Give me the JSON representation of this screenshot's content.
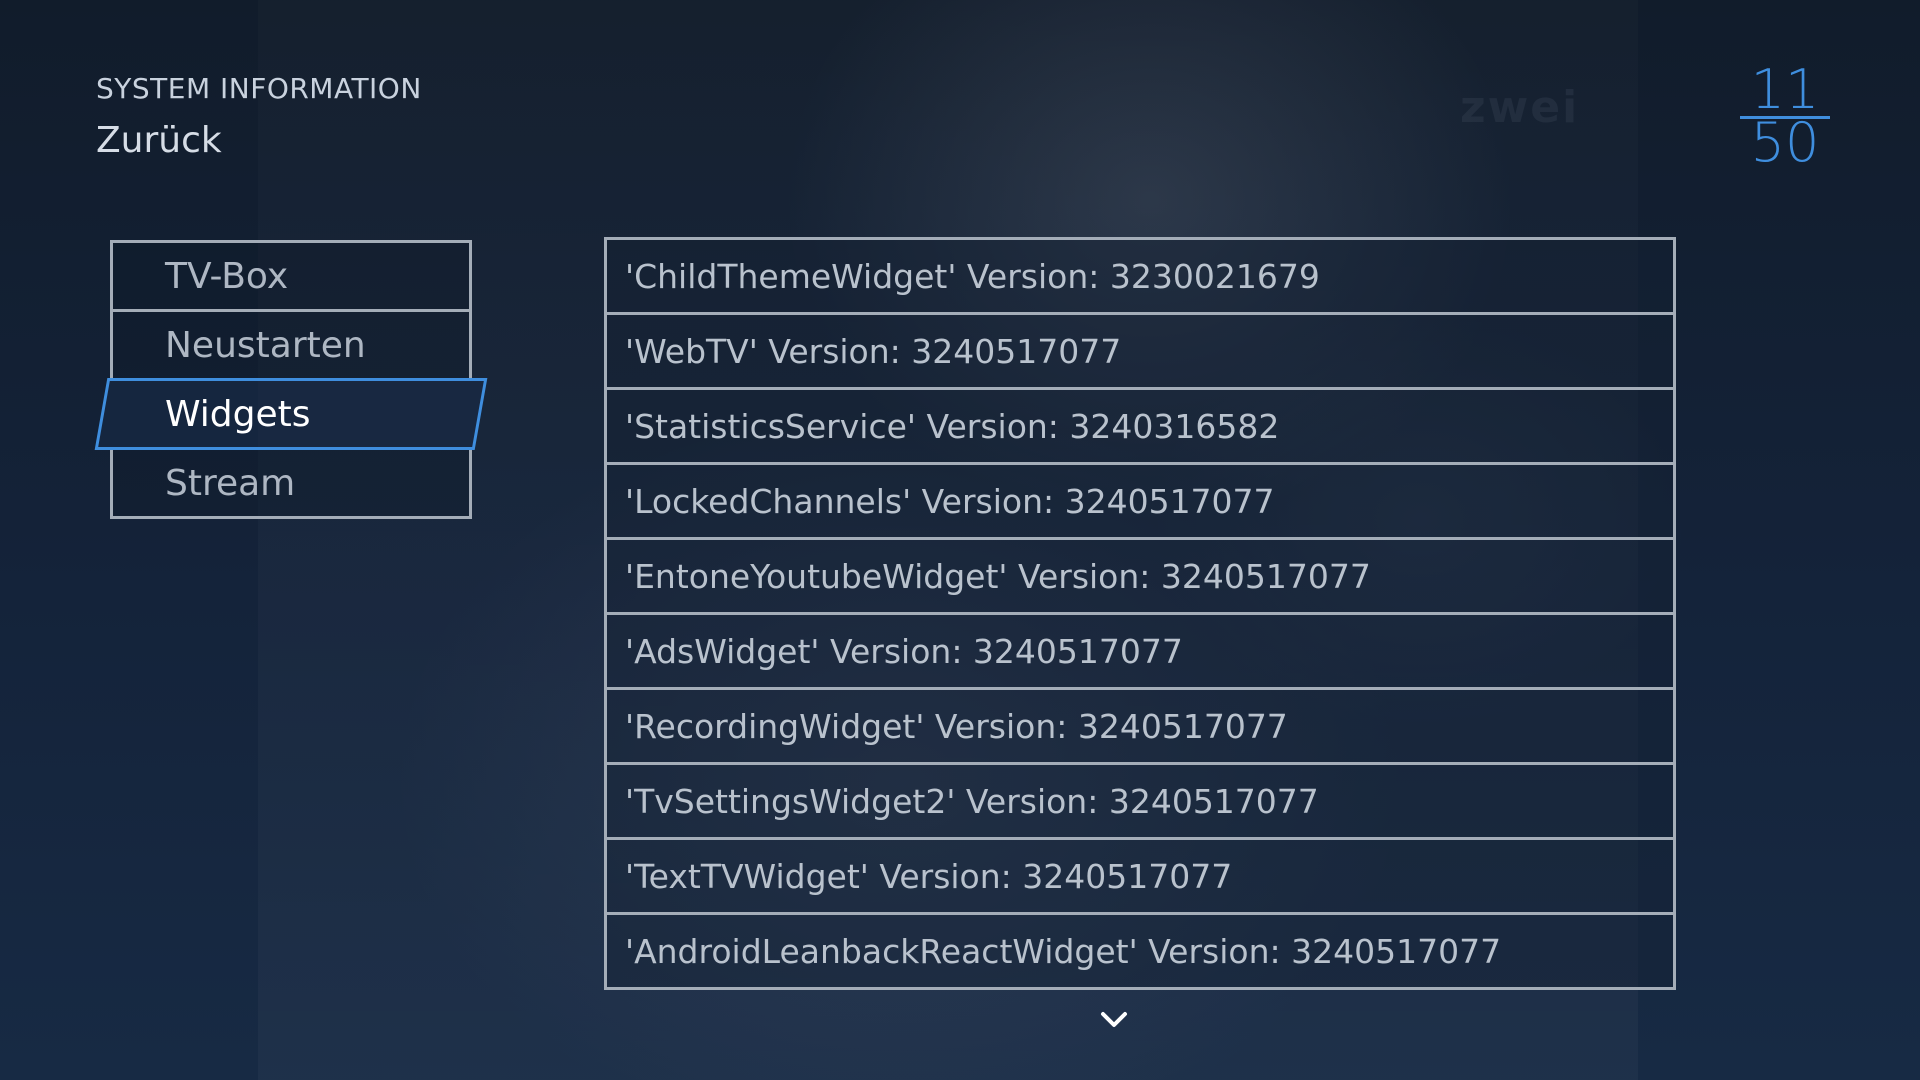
{
  "header": {
    "subtitle": "SYSTEM INFORMATION",
    "back_label": "Zurück"
  },
  "clock": {
    "hours": "11",
    "minutes": "50"
  },
  "background": {
    "watermark": "zwei"
  },
  "menu": {
    "items": [
      {
        "label": "TV-Box"
      },
      {
        "label": "Neustarten"
      },
      {
        "label": "Widgets"
      },
      {
        "label": "Stream"
      }
    ],
    "selected": "Widgets"
  },
  "widgets": {
    "rows": [
      {
        "text": "'ChildThemeWidget' Version: 3230021679"
      },
      {
        "text": "'WebTV' Version: 3240517077"
      },
      {
        "text": "'StatisticsService' Version: 3240316582"
      },
      {
        "text": "'LockedChannels' Version: 3240517077"
      },
      {
        "text": "'EntoneYoutubeWidget' Version: 3240517077"
      },
      {
        "text": "'AdsWidget' Version: 3240517077"
      },
      {
        "text": "'RecordingWidget' Version: 3240517077"
      },
      {
        "text": "'TvSettingsWidget2' Version: 3240517077"
      },
      {
        "text": "'TextTVWidget' Version: 3240517077"
      },
      {
        "text": "'AndroidLeanbackReactWidget' Version: 3240517077"
      }
    ]
  },
  "icons": {
    "scroll_down": "chevron-down-icon"
  },
  "colors": {
    "accent": "#3f8ede",
    "border": "#a4adb8",
    "background": "#0f1b2b"
  }
}
